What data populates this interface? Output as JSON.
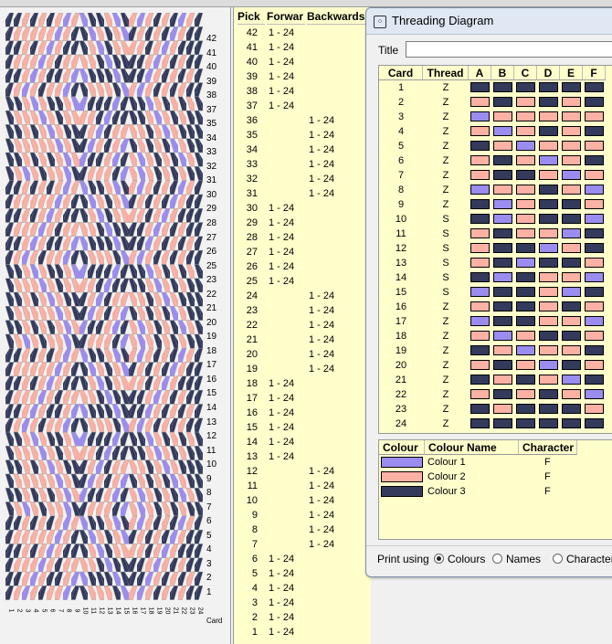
{
  "colors": {
    "colour1": "#9b8cf0",
    "colour2": "#fbb1a4",
    "colour3": "#333a5c"
  },
  "pattern": {
    "row_labels": [
      42,
      41,
      40,
      39,
      38,
      37,
      35,
      34,
      33,
      32,
      31,
      30,
      29,
      28,
      27,
      26,
      25,
      23,
      22,
      21,
      20,
      19,
      18,
      17,
      16,
      15,
      14,
      13,
      12,
      11,
      10,
      9,
      8,
      7,
      6,
      5,
      4,
      3,
      2,
      1
    ],
    "card_numbers": [
      "1",
      "2",
      "3",
      "4",
      "5",
      "6",
      "7",
      "8",
      "9",
      "10",
      "11",
      "12",
      "13",
      "14",
      "15",
      "16",
      "17",
      "18",
      "19",
      "20",
      "21",
      "22",
      "23",
      "24"
    ],
    "card_caption": "Card"
  },
  "picks": {
    "headers": {
      "pick": "Pick",
      "forward": "Forwar",
      "backwards": "Backwards"
    },
    "rows": [
      {
        "pick": "42",
        "forward": "1 - 24",
        "backwards": ""
      },
      {
        "pick": "41",
        "forward": "1 - 24",
        "backwards": ""
      },
      {
        "pick": "40",
        "forward": "1 - 24",
        "backwards": ""
      },
      {
        "pick": "39",
        "forward": "1 - 24",
        "backwards": ""
      },
      {
        "pick": "38",
        "forward": "1 - 24",
        "backwards": ""
      },
      {
        "pick": "37",
        "forward": "1 - 24",
        "backwards": ""
      },
      {
        "pick": "36",
        "forward": "",
        "backwards": "1 - 24"
      },
      {
        "pick": "35",
        "forward": "",
        "backwards": "1 - 24"
      },
      {
        "pick": "34",
        "forward": "",
        "backwards": "1 - 24"
      },
      {
        "pick": "33",
        "forward": "",
        "backwards": "1 - 24"
      },
      {
        "pick": "32",
        "forward": "",
        "backwards": "1 - 24"
      },
      {
        "pick": "31",
        "forward": "",
        "backwards": "1 - 24"
      },
      {
        "pick": "30",
        "forward": "1 - 24",
        "backwards": ""
      },
      {
        "pick": "29",
        "forward": "1 - 24",
        "backwards": ""
      },
      {
        "pick": "28",
        "forward": "1 - 24",
        "backwards": ""
      },
      {
        "pick": "27",
        "forward": "1 - 24",
        "backwards": ""
      },
      {
        "pick": "26",
        "forward": "1 - 24",
        "backwards": ""
      },
      {
        "pick": "25",
        "forward": "1 - 24",
        "backwards": ""
      },
      {
        "pick": "24",
        "forward": "",
        "backwards": "1 - 24"
      },
      {
        "pick": "23",
        "forward": "",
        "backwards": "1 - 24"
      },
      {
        "pick": "22",
        "forward": "",
        "backwards": "1 - 24"
      },
      {
        "pick": "21",
        "forward": "",
        "backwards": "1 - 24"
      },
      {
        "pick": "20",
        "forward": "",
        "backwards": "1 - 24"
      },
      {
        "pick": "19",
        "forward": "",
        "backwards": "1 - 24"
      },
      {
        "pick": "18",
        "forward": "1 - 24",
        "backwards": ""
      },
      {
        "pick": "17",
        "forward": "1 - 24",
        "backwards": ""
      },
      {
        "pick": "16",
        "forward": "1 - 24",
        "backwards": ""
      },
      {
        "pick": "15",
        "forward": "1 - 24",
        "backwards": ""
      },
      {
        "pick": "14",
        "forward": "1 - 24",
        "backwards": ""
      },
      {
        "pick": "13",
        "forward": "1 - 24",
        "backwards": ""
      },
      {
        "pick": "12",
        "forward": "",
        "backwards": "1 - 24"
      },
      {
        "pick": "11",
        "forward": "",
        "backwards": "1 - 24"
      },
      {
        "pick": "10",
        "forward": "",
        "backwards": "1 - 24"
      },
      {
        "pick": "9",
        "forward": "",
        "backwards": "1 - 24"
      },
      {
        "pick": "8",
        "forward": "",
        "backwards": "1 - 24"
      },
      {
        "pick": "7",
        "forward": "",
        "backwards": "1 - 24"
      },
      {
        "pick": "6",
        "forward": "1 - 24",
        "backwards": ""
      },
      {
        "pick": "5",
        "forward": "1 - 24",
        "backwards": ""
      },
      {
        "pick": "4",
        "forward": "1 - 24",
        "backwards": ""
      },
      {
        "pick": "3",
        "forward": "1 - 24",
        "backwards": ""
      },
      {
        "pick": "2",
        "forward": "1 - 24",
        "backwards": ""
      },
      {
        "pick": "1",
        "forward": "1 - 24",
        "backwards": ""
      }
    ]
  },
  "dialog": {
    "title": "Threading Diagram",
    "title_field_label": "Title",
    "title_field_value": "",
    "grid_headers": {
      "card": "Card",
      "thread": "Thread",
      "holes": [
        "A",
        "B",
        "C",
        "D",
        "E",
        "F"
      ]
    },
    "cards": [
      {
        "card": "1",
        "thread": "Z",
        "holes": [
          3,
          3,
          3,
          3,
          3,
          3
        ]
      },
      {
        "card": "2",
        "thread": "Z",
        "holes": [
          2,
          3,
          2,
          3,
          2,
          3
        ]
      },
      {
        "card": "3",
        "thread": "Z",
        "holes": [
          1,
          2,
          2,
          2,
          2,
          2
        ]
      },
      {
        "card": "4",
        "thread": "Z",
        "holes": [
          2,
          1,
          2,
          3,
          2,
          3
        ]
      },
      {
        "card": "5",
        "thread": "Z",
        "holes": [
          3,
          2,
          1,
          2,
          2,
          2
        ]
      },
      {
        "card": "6",
        "thread": "Z",
        "holes": [
          2,
          3,
          2,
          1,
          2,
          3
        ]
      },
      {
        "card": "7",
        "thread": "Z",
        "holes": [
          2,
          3,
          3,
          2,
          1,
          2
        ]
      },
      {
        "card": "8",
        "thread": "Z",
        "holes": [
          1,
          2,
          2,
          3,
          2,
          1
        ]
      },
      {
        "card": "9",
        "thread": "Z",
        "holes": [
          3,
          1,
          2,
          3,
          3,
          2
        ]
      },
      {
        "card": "10",
        "thread": "S",
        "holes": [
          3,
          1,
          2,
          3,
          3,
          1
        ]
      },
      {
        "card": "11",
        "thread": "S",
        "holes": [
          2,
          3,
          2,
          2,
          1,
          3
        ]
      },
      {
        "card": "12",
        "thread": "S",
        "holes": [
          2,
          3,
          3,
          1,
          2,
          3
        ]
      },
      {
        "card": "13",
        "thread": "S",
        "holes": [
          2,
          3,
          1,
          3,
          3,
          2
        ]
      },
      {
        "card": "14",
        "thread": "S",
        "holes": [
          3,
          1,
          3,
          2,
          2,
          1
        ]
      },
      {
        "card": "15",
        "thread": "S",
        "holes": [
          1,
          3,
          3,
          2,
          1,
          3
        ]
      },
      {
        "card": "16",
        "thread": "Z",
        "holes": [
          2,
          3,
          3,
          2,
          3,
          2
        ]
      },
      {
        "card": "17",
        "thread": "Z",
        "holes": [
          1,
          3,
          3,
          2,
          2,
          1
        ]
      },
      {
        "card": "18",
        "thread": "Z",
        "holes": [
          2,
          1,
          2,
          3,
          3,
          2
        ]
      },
      {
        "card": "19",
        "thread": "Z",
        "holes": [
          3,
          2,
          1,
          2,
          2,
          3
        ]
      },
      {
        "card": "20",
        "thread": "Z",
        "holes": [
          2,
          3,
          2,
          1,
          3,
          2
        ]
      },
      {
        "card": "21",
        "thread": "Z",
        "holes": [
          3,
          2,
          3,
          2,
          1,
          3
        ]
      },
      {
        "card": "22",
        "thread": "Z",
        "holes": [
          2,
          3,
          2,
          3,
          2,
          1
        ]
      },
      {
        "card": "23",
        "thread": "Z",
        "holes": [
          3,
          2,
          3,
          3,
          3,
          2
        ]
      },
      {
        "card": "24",
        "thread": "Z",
        "holes": [
          3,
          3,
          3,
          3,
          3,
          3
        ]
      }
    ],
    "colour_headers": {
      "colour": "Colour",
      "name": "Colour Name",
      "character": "Character"
    },
    "colours": [
      {
        "name": "Colour 1",
        "character": "F",
        "color": "#9b8cf0"
      },
      {
        "name": "Colour 2",
        "character": "F",
        "color": "#fbb1a4"
      },
      {
        "name": "Colour 3",
        "character": "F",
        "color": "#333a5c"
      }
    ],
    "print_using": {
      "label": "Print using",
      "options": [
        "Colours",
        "Names",
        "Characters"
      ],
      "selected": "Colours"
    }
  }
}
